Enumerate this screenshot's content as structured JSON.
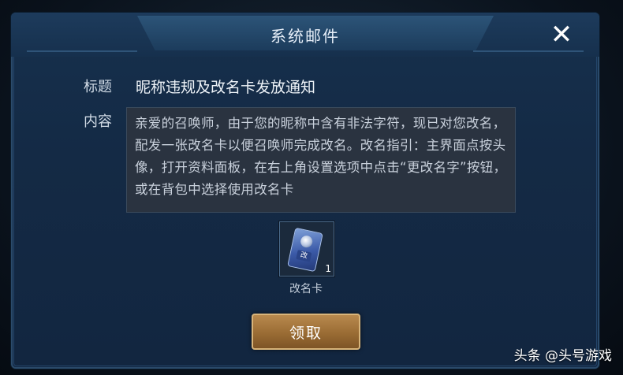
{
  "dialog": {
    "title": "系统邮件",
    "close_icon": "close-icon"
  },
  "mail": {
    "subject_label": "标题",
    "subject": "昵称违规及改名卡发放通知",
    "content_label": "内容",
    "content": "亲爱的召唤师，由于您的昵称中含有非法字符，现已对您改名，配发一张改名卡以便召唤师完成改名。改名指引：主界面点按头像，打开资料面板，在右上角设置选项中点击“更改名字”按钮，或在背包中选择使用改名卡"
  },
  "attachment": {
    "name": "改名卡",
    "count": "1",
    "icon": "rename-card-icon",
    "card_mark": "改"
  },
  "claim_button": {
    "label": "领取"
  },
  "watermark": {
    "text": "头条 @头号游戏"
  },
  "colors": {
    "dialog_bg": "#16304d",
    "button_gold": "#b8894e",
    "text_light": "#e6eef8"
  }
}
